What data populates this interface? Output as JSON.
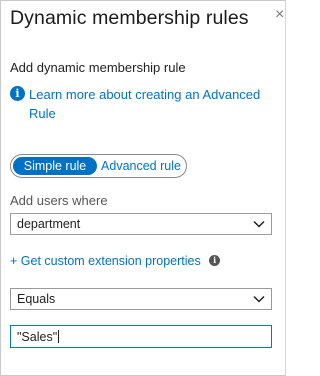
{
  "panel": {
    "title": "Dynamic membership rules",
    "close_glyph": "×"
  },
  "rule_section": {
    "heading": "Add dynamic membership rule",
    "info_icon": "info-icon",
    "learn_more_link": "Learn more about creating an Advanced Rule"
  },
  "mode_toggle": {
    "options": [
      "Simple rule",
      "Advanced rule"
    ],
    "selected": "Simple rule"
  },
  "rule_builder": {
    "add_users_label": "Add users where",
    "property_select": {
      "value": "department"
    },
    "custom_properties_link": "+ Get custom extension properties",
    "custom_properties_info_icon": "info-icon",
    "operator_select": {
      "value": "Equals"
    },
    "value_input": {
      "value": "\"Sales\""
    }
  },
  "colors": {
    "accent": "#0072c6",
    "input_focus_border": "#0078d4"
  }
}
